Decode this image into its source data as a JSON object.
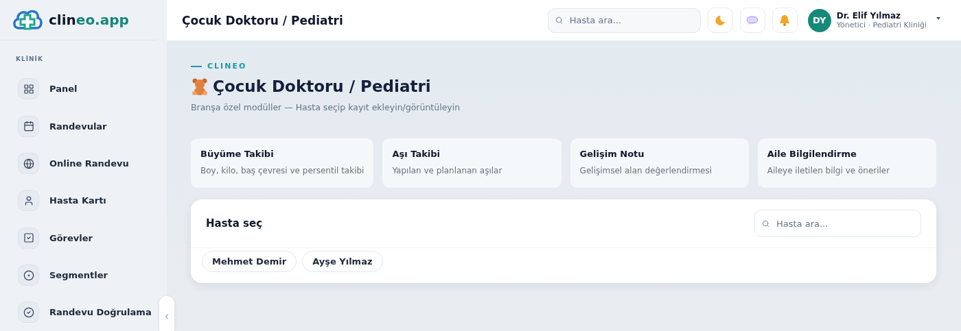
{
  "brand": {
    "name_start": "clin",
    "name_end": "eo.app"
  },
  "sidebar": {
    "section": "KLİNİK",
    "items": [
      {
        "label": "Panel",
        "kind": "grid"
      },
      {
        "label": "Randevular",
        "kind": "calendar"
      },
      {
        "label": "Online Randevu",
        "kind": "globe"
      },
      {
        "label": "Hasta Kartı",
        "kind": "user"
      },
      {
        "label": "Görevler",
        "kind": "check-square"
      },
      {
        "label": "Segmentler",
        "kind": "target"
      },
      {
        "label": "Randevu Doğrulama",
        "kind": "check-circle"
      }
    ]
  },
  "header": {
    "title": "Çocuk Doktoru / Pediatri",
    "search": {
      "placeholder": "Hasta ara..."
    },
    "user": {
      "initials": "DY",
      "name": "Dr. Elif Yılmaz",
      "role": "Yönetici · Pediatri Kliniği"
    }
  },
  "page": {
    "eyebrow": "CLINEO",
    "title": "Çocuk Doktoru / Pediatri",
    "subtitle": "Branşa özel modüller — Hasta seçip kayıt ekleyin/görüntüleyin"
  },
  "modules": [
    {
      "title": "Büyüme Takibi",
      "description": "Boy, kilo, baş çevresi ve persentil takibi"
    },
    {
      "title": "Aşı Takibi",
      "description": "Yapılan ve planlanan aşılar"
    },
    {
      "title": "Gelişim Notu",
      "description": "Gelişimsel alan değerlendirmesi"
    },
    {
      "title": "Aile Bilgilendirme",
      "description": "Aileye iletilen bilgi ve öneriler"
    }
  ],
  "patient_picker": {
    "title": "Hasta seç",
    "search": {
      "placeholder": "Hasta ara..."
    },
    "patients": [
      "Mehmet Demir",
      "Ayşe Yılmaz"
    ]
  }
}
